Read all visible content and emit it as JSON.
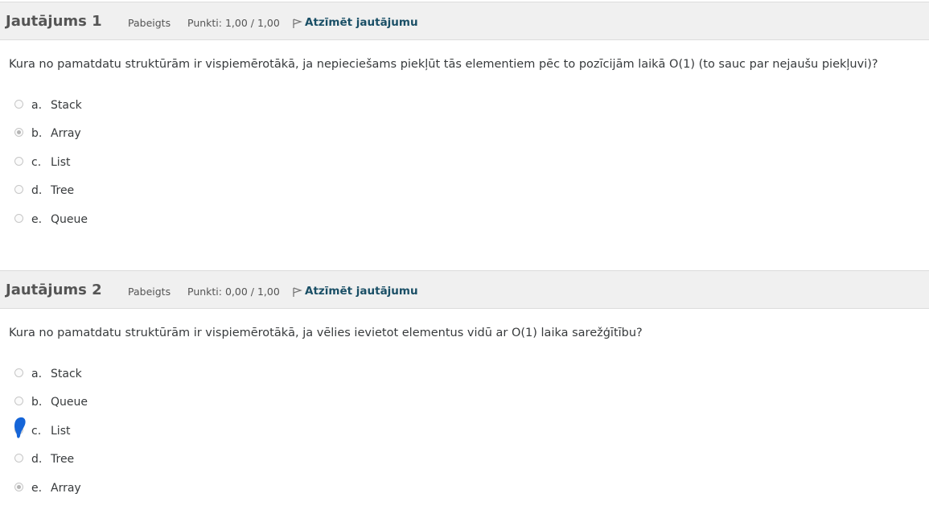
{
  "questions": [
    {
      "title": "Jautājums 1",
      "state": "Pabeigts",
      "grade": "Punkti: 1,00 / 1,00",
      "flag_label": "Atzīmēt jautājumu",
      "text": "Kura no pamatdatu struktūrām ir vispiemērotākā, ja nepieciešams piekļūt tās elementiem pēc to pozīcijām laikā O(1) (to sauc par nejaušu piekļuvi)?",
      "answers": [
        {
          "letter": "a.",
          "text": "Stack",
          "selected": false
        },
        {
          "letter": "b.",
          "text": "Array",
          "selected": true
        },
        {
          "letter": "c.",
          "text": "List",
          "selected": false
        },
        {
          "letter": "d.",
          "text": "Tree",
          "selected": false
        },
        {
          "letter": "e.",
          "text": "Queue",
          "selected": false
        }
      ]
    },
    {
      "title": "Jautājums 2",
      "state": "Pabeigts",
      "grade": "Punkti: 0,00 / 1,00",
      "flag_label": "Atzīmēt jautājumu",
      "text": "Kura no pamatdatu struktūrām ir vispiemērotākā, ja vēlies ievietot elementus vidū ar O(1) laika sarežģītību?",
      "answers": [
        {
          "letter": "a.",
          "text": "Stack",
          "selected": false
        },
        {
          "letter": "b.",
          "text": "Queue",
          "selected": false
        },
        {
          "letter": "c.",
          "text": "List",
          "selected": false
        },
        {
          "letter": "d.",
          "text": "Tree",
          "selected": false
        },
        {
          "letter": "e.",
          "text": "Array",
          "selected": true
        }
      ]
    }
  ],
  "colors": {
    "header_bg": "#f0f0f0",
    "flag_link": "#1a4f66",
    "scribble": "#1565d8"
  },
  "icons": {
    "flag": "flag-icon",
    "radio": "radio-icon"
  }
}
